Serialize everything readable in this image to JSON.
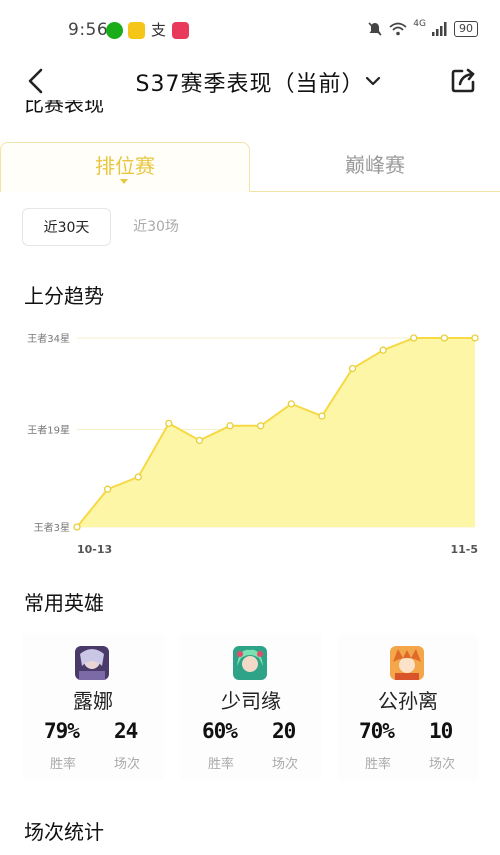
{
  "status": {
    "time": "9:56",
    "zhi_app": "支",
    "network": "4G",
    "battery": "90"
  },
  "header": {
    "title": "S37赛季表现（当前）"
  },
  "section_cut_title": "比赛表现",
  "tabs": [
    {
      "label": "排位赛",
      "active": true
    },
    {
      "label": "巅峰赛",
      "active": false
    }
  ],
  "filters": [
    {
      "label": "近30天",
      "active": true
    },
    {
      "label": "近30场",
      "active": false
    }
  ],
  "trend": {
    "title": "上分趋势"
  },
  "chart_data": {
    "type": "area",
    "title": "上分趋势",
    "y_tick_labels": [
      "王者3星",
      "王者19星",
      "王者34星"
    ],
    "y_ticks": [
      3,
      19,
      34
    ],
    "ylim": [
      3,
      34
    ],
    "x_tick_labels": [
      "10-13",
      "11-5"
    ],
    "series": [
      {
        "values": [
          3,
          9.2,
          11.2,
          20,
          17.2,
          19.6,
          19.6,
          23.2,
          21.2,
          29,
          32,
          34,
          34,
          34
        ]
      }
    ],
    "grid": true,
    "line_color": "#f5d945",
    "fill_color": "#fdf6a6"
  },
  "heroes_section": {
    "title": "常用英雄",
    "heroes": [
      {
        "name": "露娜",
        "win_rate": "79%",
        "win_rate_label": "胜率",
        "games": "24",
        "games_label": "场次"
      },
      {
        "name": "少司缘",
        "win_rate": "60%",
        "win_rate_label": "胜率",
        "games": "20",
        "games_label": "场次"
      },
      {
        "name": "公孙离",
        "win_rate": "70%",
        "win_rate_label": "胜率",
        "games": "10",
        "games_label": "场次"
      }
    ]
  },
  "stats_section": {
    "title": "场次统计"
  }
}
